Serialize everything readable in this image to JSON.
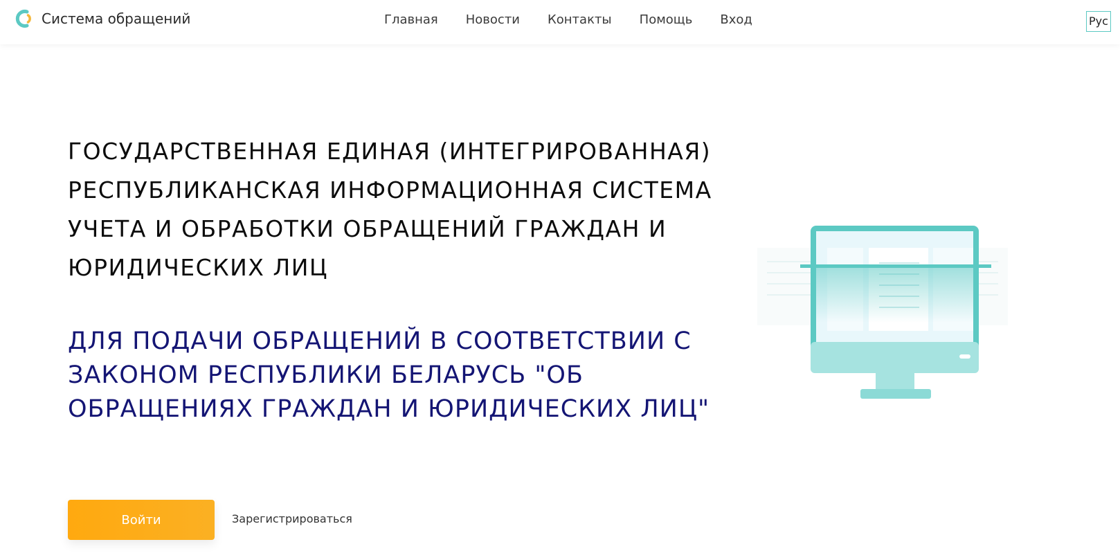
{
  "header": {
    "brand": "Система обращений",
    "nav": [
      "Главная",
      "Новости",
      "Контакты",
      "Помощь",
      "Вход"
    ],
    "lang": "Рус"
  },
  "hero": {
    "title": "ГОСУДАРСТВЕННАЯ ЕДИНАЯ (ИНТЕГРИРОВАННАЯ) РЕСПУБЛИКАНСКАЯ ИНФОРМАЦИОННАЯ СИСТЕМА УЧЕТА И ОБРАБОТКИ ОБРАЩЕНИЙ ГРАЖДАН И ЮРИДИЧЕСКИХ ЛИЦ",
    "subtitle": "ДЛЯ ПОДАЧИ ОБРАЩЕНИЙ В СООТВЕТСТВИИ С ЗАКОНОМ РЕСПУБЛИКИ БЕЛАРУСЬ \"ОБ ОБРАЩЕНИЯХ ГРАЖДАН И ЮРИДИЧЕСКИХ ЛИЦ\"",
    "login_label": "Войти",
    "register_label": "Зарегистрироваться"
  },
  "colors": {
    "accent_teal": "#5cc9c3",
    "button_orange": "#ffa90f",
    "subtitle_navy": "#141574"
  },
  "icons": {
    "logo": "circle-logo-icon",
    "illustration": "monitor-icon"
  }
}
